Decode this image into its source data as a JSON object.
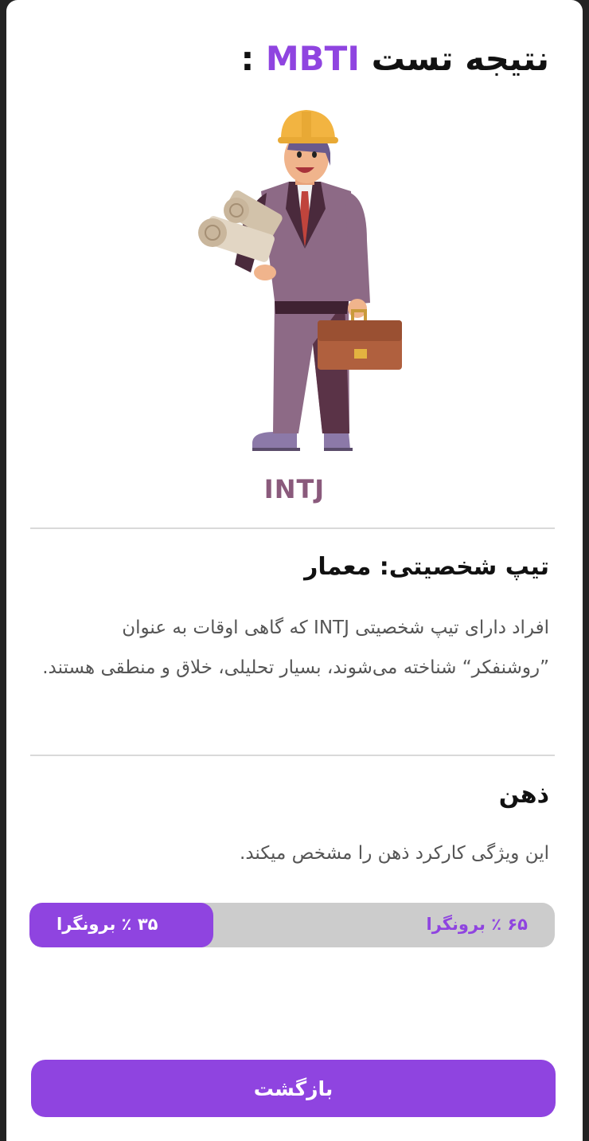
{
  "header": {
    "title_prefix": "نتیجه تست",
    "title_accent": "MBTI",
    "title_suffix": ":"
  },
  "result": {
    "type_code": "INTJ",
    "personality_title": "تیپ شخصیتی: معمار",
    "description": "افراد دارای تیپ شخصیتی INTJ که گاهی اوقات به عنوان ”روشنفکر“ شناخته می‌شوند، بسیار تحلیلی، خلاق و منطقی هستند."
  },
  "mind_section": {
    "title": "ذهن",
    "subtitle": "این ویژگی کارکرد ذهن را مشخص میکند.",
    "bar": {
      "fill_percent": 35,
      "left_label": "۳۵ ٪ برونگرا",
      "right_label": "۶۵ ٪ برونگرا"
    }
  },
  "footer": {
    "back_label": "بازگشت"
  },
  "colors": {
    "accent": "#8f44e0",
    "type_code": "#8a5a7c",
    "bar_track": "#cccccc"
  },
  "illustration": {
    "icon": "architect-illustration"
  }
}
